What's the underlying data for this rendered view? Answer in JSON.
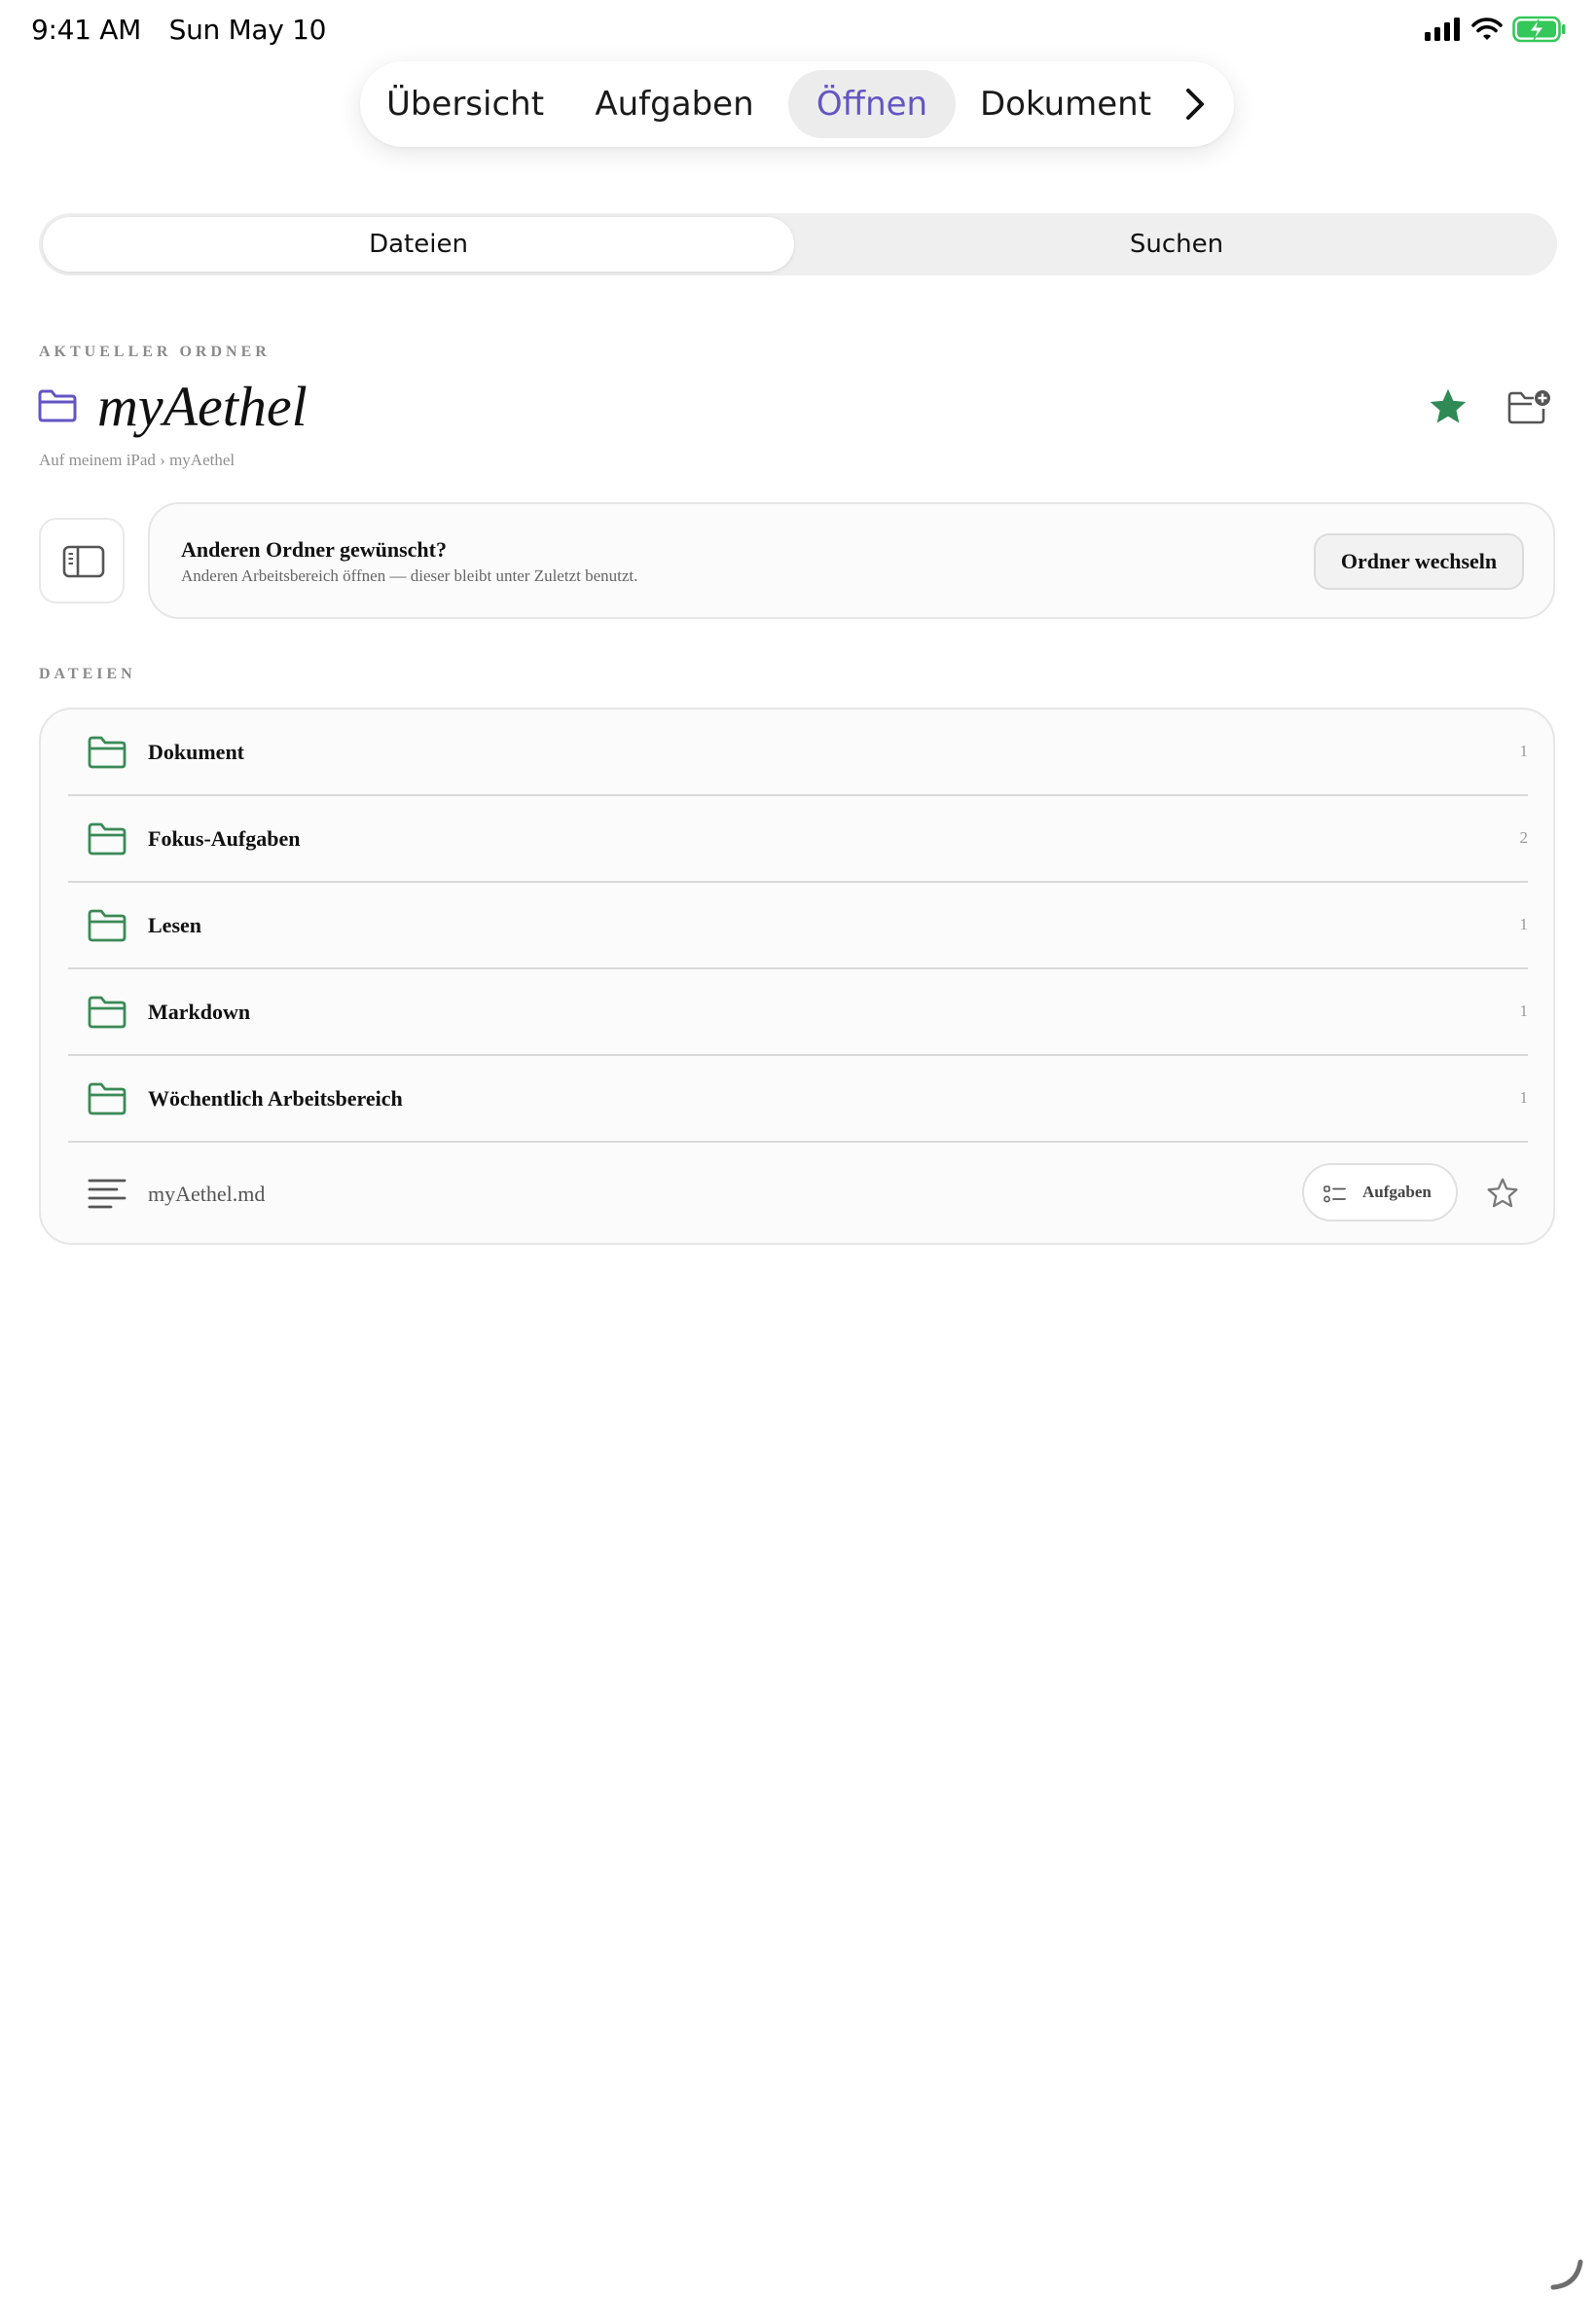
{
  "status_bar": {
    "time": "9:41 AM",
    "date": "Sun May 10"
  },
  "nav": {
    "tabs": [
      {
        "label": "Übersicht"
      },
      {
        "label": "Aufgaben"
      },
      {
        "label": "Öffnen"
      },
      {
        "label": "Dokument"
      }
    ],
    "active": "Öffnen"
  },
  "segments": {
    "files": "Dateien",
    "search": "Suchen",
    "active": "Dateien"
  },
  "current_folder": {
    "section_label": "AKTUELLER ORDNER",
    "name": "myAethel",
    "breadcrumb": "Auf meinem iPad › myAethel",
    "favorite": true
  },
  "change_folder": {
    "title": "Anderen Ordner gewünscht?",
    "subtitle": "Anderen Arbeitsbereich öffnen — dieser bleibt unter Zuletzt benutzt.",
    "button": "Ordner wechseln"
  },
  "files": {
    "section_label": "DATEIEN",
    "folders": [
      {
        "name": "Dokument",
        "count": "1"
      },
      {
        "name": "Fokus-Aufgaben",
        "count": "2"
      },
      {
        "name": "Lesen",
        "count": "1"
      },
      {
        "name": "Markdown",
        "count": "1"
      },
      {
        "name": "Wöchentlich Arbeitsbereich",
        "count": "1"
      }
    ],
    "document": {
      "name": "myAethel.md",
      "tasks_button": "Aufgaben"
    }
  },
  "colors": {
    "accent_purple": "#6355c4",
    "folder_green": "#3a8a56",
    "star_green": "#2f8a56"
  }
}
